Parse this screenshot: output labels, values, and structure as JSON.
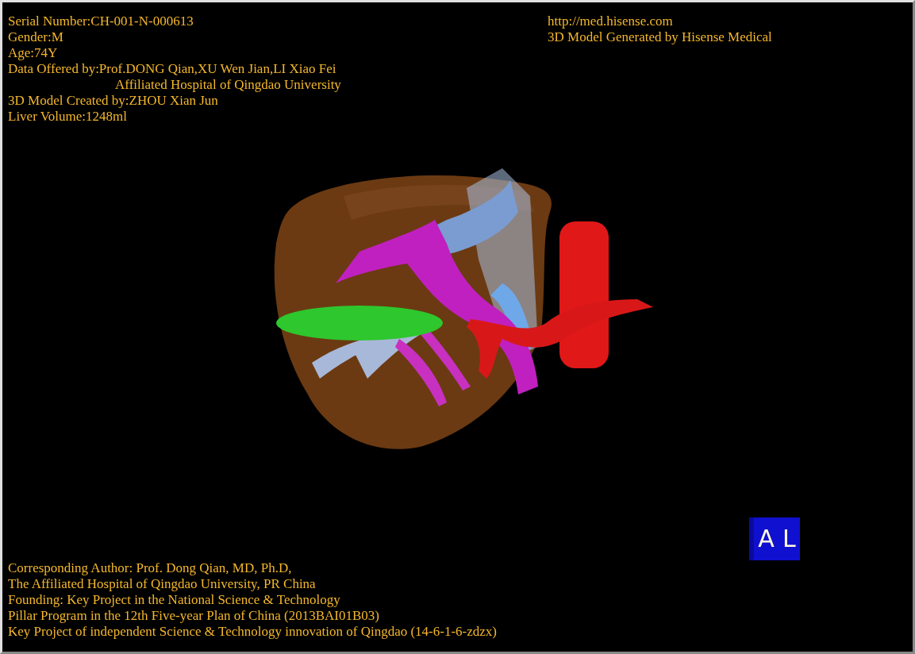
{
  "viewer": {
    "top_left": [
      {
        "text": "Serial Number:CH-001-N-000613",
        "kind": "line"
      },
      {
        "text": "Gender:M",
        "kind": "line"
      },
      {
        "text": "Age:74Y",
        "kind": "line"
      },
      {
        "text": "Data Offered by:Prof.DONG Qian,XU Wen Jian,LI Xiao Fei",
        "kind": "line"
      },
      {
        "text": "Affiliated Hospital of Qingdao University",
        "kind": "continuation"
      },
      {
        "text": "3D Model Created by:ZHOU Xian Jun",
        "kind": "line"
      },
      {
        "text": "Liver Volume:1248ml",
        "kind": "line"
      }
    ],
    "top_right": [
      "http://med.hisense.com",
      "3D Model Generated by Hisense Medical"
    ],
    "orientation_cube": {
      "labels": [
        "A",
        "L"
      ]
    },
    "bottom_left": [
      "Corresponding Author: Prof. Dong Qian, MD, Ph.D,",
      "The Affiliated Hospital of Qingdao University, PR China",
      "Founding: Key Project in the National Science & Technology",
      "Pillar Program in the 12th Five-year Plan of China (2013BAI01B03)",
      "Key Project of independent Science & Technology innovation of Qingdao (14-6-1-6-zdzx)"
    ]
  }
}
